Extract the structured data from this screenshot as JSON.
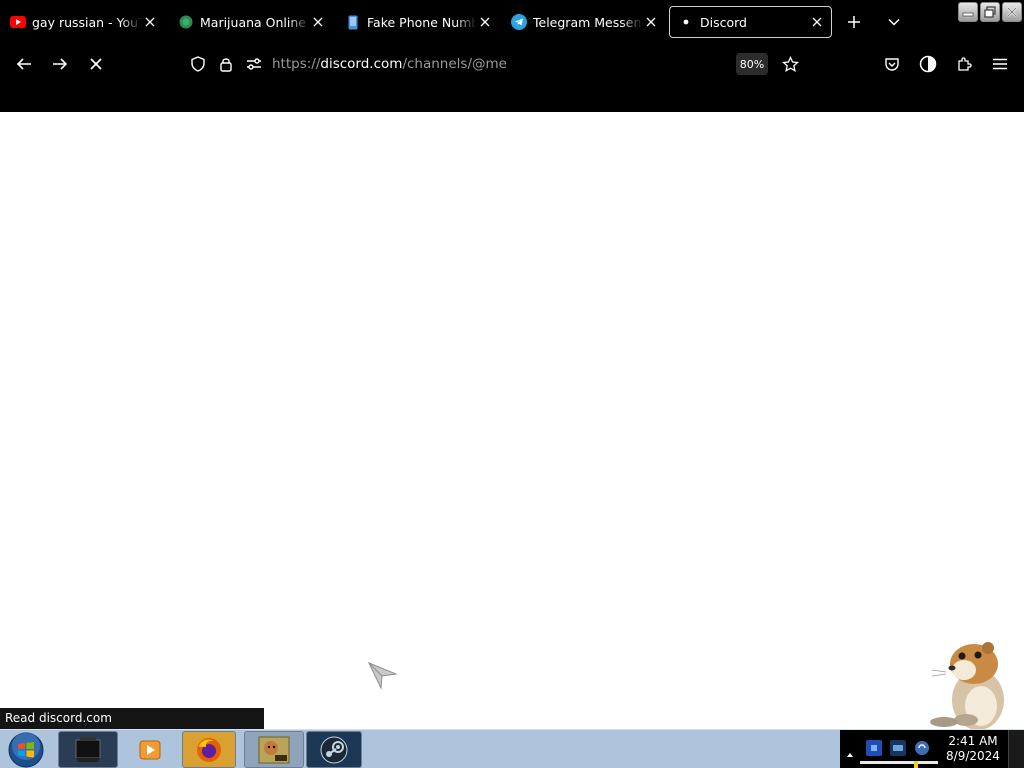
{
  "window": {
    "buttons": [
      "minimize",
      "restore",
      "close"
    ]
  },
  "tabs": [
    {
      "title": "gay russian - YouTube",
      "favicon": "youtube-icon",
      "color": "#ff0000",
      "active": false
    },
    {
      "title": "Marijuana Online Dispensary",
      "favicon": "globe-green-icon",
      "color": "#2e8b57",
      "active": false
    },
    {
      "title": "Fake Phone Number",
      "favicon": "phone-icon",
      "color": "#4a90e2",
      "active": false
    },
    {
      "title": "Telegram Messenger",
      "favicon": "telegram-icon",
      "color": "#2aa3df",
      "active": false
    },
    {
      "title": "Discord",
      "favicon": "loading-dot-icon",
      "color": "#ffffff",
      "active": true
    }
  ],
  "nav": {
    "url_scheme": "https://",
    "url_host": "discord.com",
    "url_path": "/channels/@me",
    "zoom": "80%"
  },
  "status_bar": {
    "text": "Read discord.com"
  },
  "taskbar": {
    "pinned": [
      "start-orb-icon",
      "black-window-icon",
      "media-player-icon",
      "firefox-icon",
      "game-box-icon",
      "steam-icon"
    ],
    "clock_time": "2:41 AM",
    "clock_date": "8/9/2024"
  },
  "colors": {
    "chrome": "#000000",
    "taskbar": "#adc4dc",
    "active_tab_border": "#cfcfcf"
  }
}
